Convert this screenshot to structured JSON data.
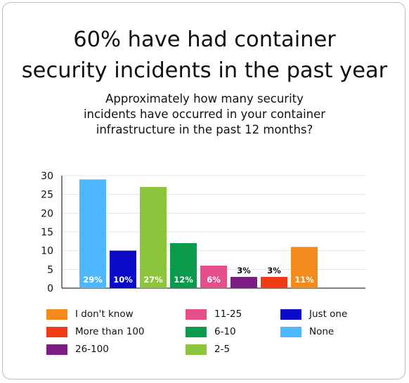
{
  "title": "60% have had container\nsecurity incidents in the past year",
  "subtitle": "Approximately how many security\nincidents have occurred in your container\ninfrastructure in the past 12 months?",
  "chart_data": {
    "type": "bar",
    "title": "60% have had container security incidents in the past year",
    "subtitle": "Approximately how many security incidents have occurred in your container infrastructure in the past 12 months?",
    "xlabel": "",
    "ylabel": "",
    "ylim": [
      0,
      30
    ],
    "yticks": [
      0,
      5,
      10,
      15,
      20,
      25,
      30
    ],
    "grid": true,
    "legend_position": "bottom",
    "categories": [
      "None",
      "Just one",
      "2-5",
      "6-10",
      "11-25",
      "26-100",
      "More than 100",
      "I don't know"
    ],
    "values": [
      29,
      10,
      27,
      12,
      6,
      3,
      3,
      11
    ],
    "data_labels": [
      "29%",
      "10%",
      "27%",
      "12%",
      "6%",
      "3%",
      "3%",
      "11%"
    ],
    "colors": [
      "#4db8ff",
      "#0a0ac8",
      "#8cc43c",
      "#0a9a4b",
      "#e6508a",
      "#7a1e83",
      "#f03c14",
      "#f28a1e"
    ]
  },
  "legend": [
    {
      "label": "I don't know",
      "color": "#f28a1e"
    },
    {
      "label": "11-25",
      "color": "#e6508a"
    },
    {
      "label": "Just one",
      "color": "#0a0ac8"
    },
    {
      "label": "More than 100",
      "color": "#f03c14"
    },
    {
      "label": "6-10",
      "color": "#0a9a4b"
    },
    {
      "label": "None",
      "color": "#4db8ff"
    },
    {
      "label": "26-100",
      "color": "#7a1e83"
    },
    {
      "label": "2-5",
      "color": "#8cc43c"
    }
  ]
}
